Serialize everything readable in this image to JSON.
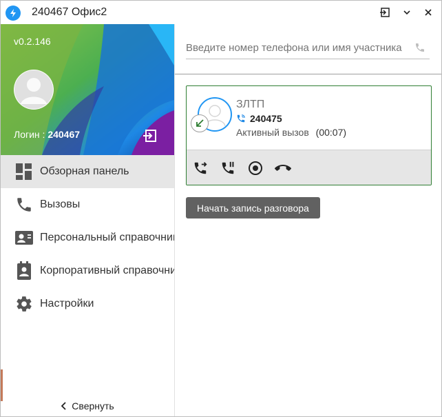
{
  "window": {
    "title": "240467 Офис2"
  },
  "sidebar": {
    "version": "v0.2.146",
    "login_label": "Логин :",
    "login_value": "240467",
    "items": [
      {
        "label": "Обзорная панель",
        "icon": "dashboard-icon",
        "active": true
      },
      {
        "label": "Вызовы",
        "icon": "phone-icon",
        "active": false
      },
      {
        "label": "Персональный справочник",
        "icon": "contact-card-icon",
        "active": false
      },
      {
        "label": "Корпоративный справочник",
        "icon": "contact-book-icon",
        "active": false
      },
      {
        "label": "Настройки",
        "icon": "gear-icon",
        "active": false
      }
    ],
    "collapse_label": "Свернуть"
  },
  "search": {
    "placeholder": "Введите номер телефона или имя участника"
  },
  "call_card": {
    "name": "ЗЛТП",
    "number": "240475",
    "status": "Активный вызов",
    "duration": "(00:07)",
    "direction_icon": "incoming-call-arrow-icon",
    "actions": [
      "transfer-call-icon",
      "hold-call-icon",
      "record-icon",
      "hangup-icon"
    ]
  },
  "tooltip": {
    "text": "Начать запись разговора"
  },
  "colors": {
    "accent": "#2196f3",
    "card_border": "#2e7d32",
    "active_menu_bg": "#e6e6e6",
    "tooltip_bg": "#616161",
    "incoming_arrow": "#2e7d32"
  }
}
